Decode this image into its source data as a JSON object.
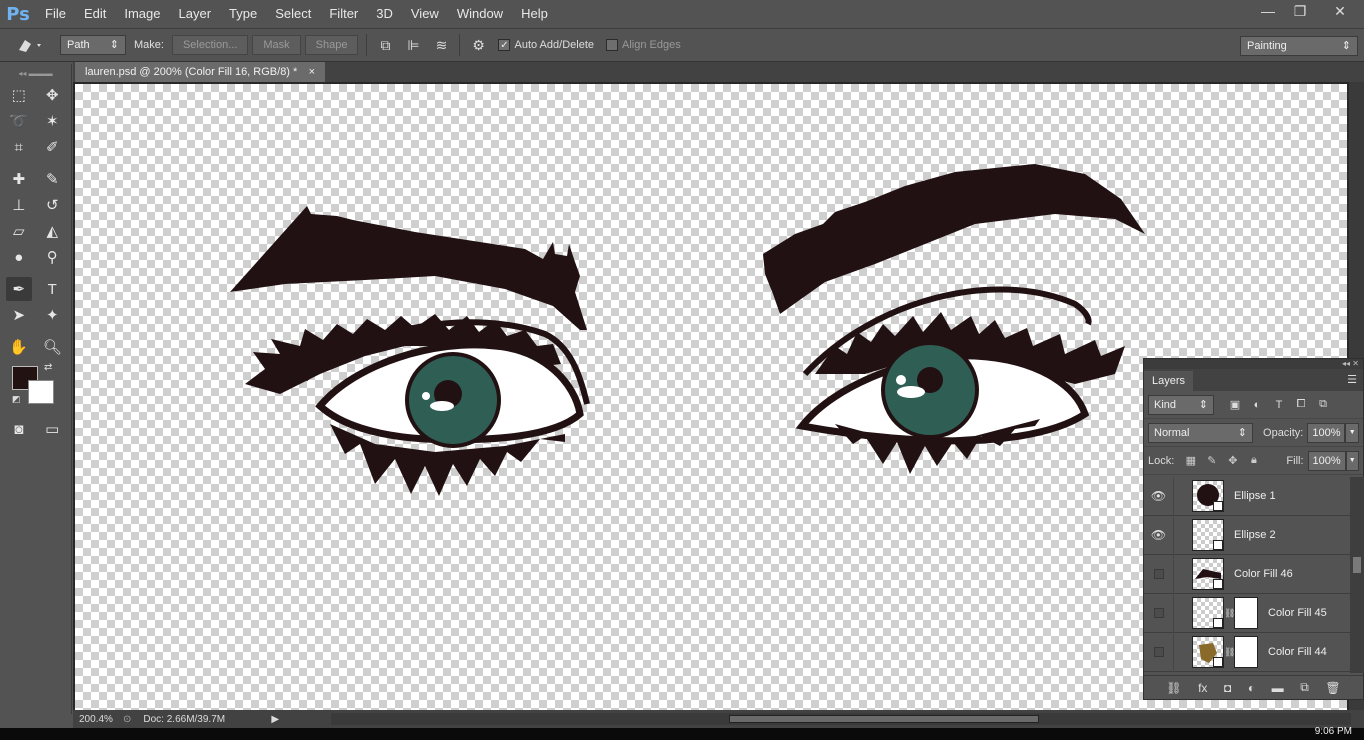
{
  "app": {
    "logo": "Ps"
  },
  "menu": [
    "File",
    "Edit",
    "Image",
    "Layer",
    "Type",
    "Select",
    "Filter",
    "3D",
    "View",
    "Window",
    "Help"
  ],
  "window_controls": {
    "minimize": "—",
    "restore": "❐",
    "close": "✕"
  },
  "options": {
    "mode_value": "Path",
    "make_label": "Make:",
    "selection_label": "Selection...",
    "mask_label": "Mask",
    "shape_label": "Shape",
    "auto_add_delete_label": "Auto Add/Delete",
    "auto_add_delete_checked": true,
    "align_edges_label": "Align Edges",
    "align_edges_checked": false,
    "workspace_value": "Painting"
  },
  "document": {
    "tab_title": "lauren.psd @ 200% (Color Fill 16, RGB/8) *",
    "close": "×"
  },
  "status": {
    "zoom": "200.4%",
    "doc": "Doc: 2.66M/39.7M"
  },
  "colors": {
    "foreground": "#231212",
    "background": "#ffffff",
    "iris": "#2f5e55",
    "ink": "#221112"
  },
  "layers_panel": {
    "tab_label": "Layers",
    "filter_value": "Kind",
    "blend_mode": "Normal",
    "opacity_label": "Opacity:",
    "opacity_value": "100%",
    "lock_label": "Lock:",
    "fill_label": "Fill:",
    "fill_value": "100%",
    "layers": [
      {
        "name": "Ellipse 1",
        "visible": true
      },
      {
        "name": "Ellipse 2",
        "visible": true
      },
      {
        "name": "Color Fill 46",
        "visible": false
      },
      {
        "name": "Color Fill 45",
        "visible": false
      },
      {
        "name": "Color Fill 44",
        "visible": false
      }
    ]
  },
  "taskbar": {
    "clock": "9:06 PM"
  }
}
